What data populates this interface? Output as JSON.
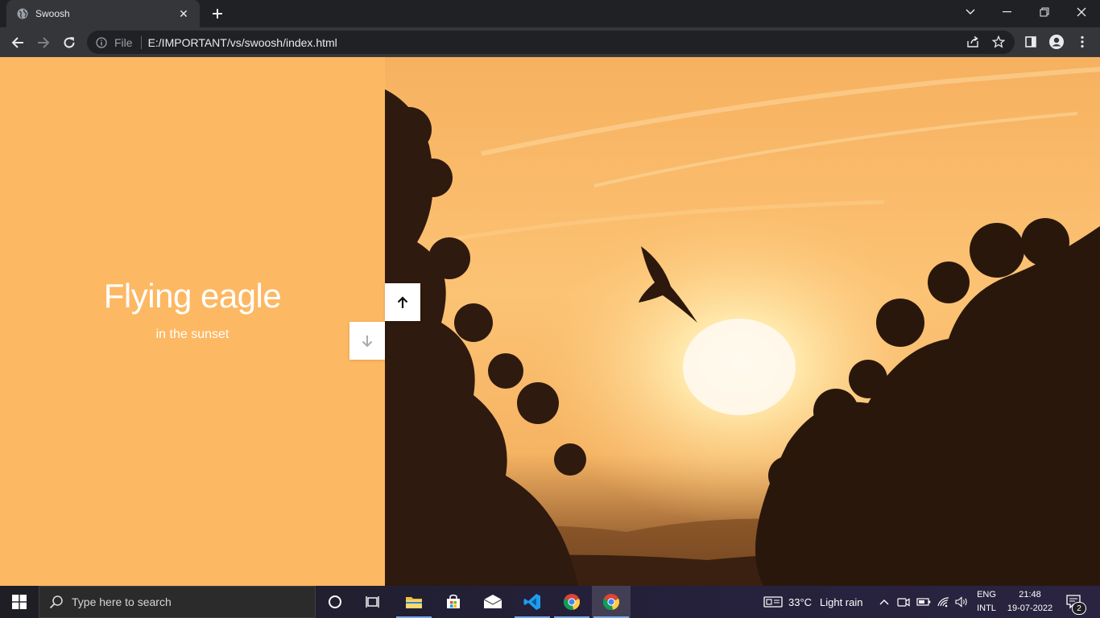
{
  "browser": {
    "tab_title": "Swoosh",
    "close_glyph": "✕",
    "scheme_label": "File",
    "url": "E:/IMPORTANT/vs/swoosh/index.html"
  },
  "page": {
    "headline": "Flying eagle",
    "subheadline": "in the sunset",
    "panel_color": "#fdb863",
    "buttons": {
      "up": "up-arrow-icon",
      "down": "down-arrow-icon"
    }
  },
  "taskbar": {
    "search_placeholder": "Type here to search",
    "weather_temp": "33°C",
    "weather_desc": "Light rain",
    "lang_line1": "ENG",
    "lang_line2": "INTL",
    "time": "21:48",
    "date": "19-07-2022",
    "notification_count": "2",
    "pinned": [
      "cortana-icon",
      "task-view-icon",
      "file-explorer-icon",
      "microsoft-store-icon",
      "mail-icon",
      "vscode-icon",
      "chrome-icon",
      "chrome-icon"
    ]
  }
}
